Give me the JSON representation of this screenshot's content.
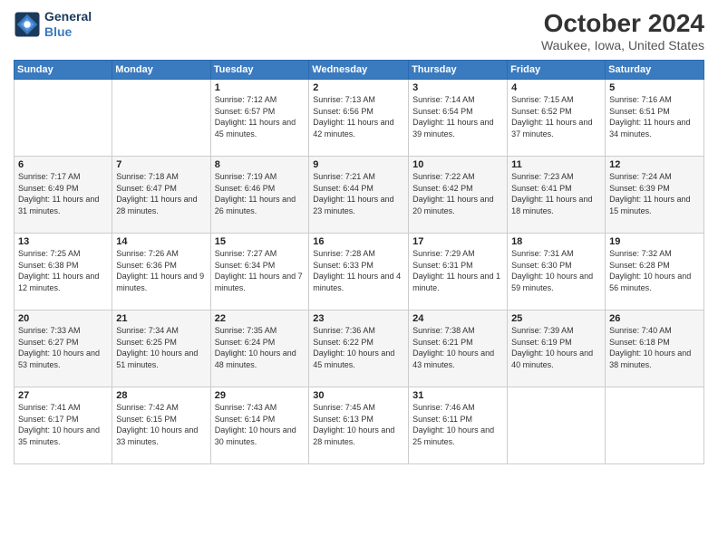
{
  "header": {
    "logo_line1": "General",
    "logo_line2": "Blue",
    "title": "October 2024",
    "subtitle": "Waukee, Iowa, United States"
  },
  "weekdays": [
    "Sunday",
    "Monday",
    "Tuesday",
    "Wednesday",
    "Thursday",
    "Friday",
    "Saturday"
  ],
  "weeks": [
    [
      {
        "day": "",
        "info": ""
      },
      {
        "day": "",
        "info": ""
      },
      {
        "day": "1",
        "info": "Sunrise: 7:12 AM\nSunset: 6:57 PM\nDaylight: 11 hours and 45 minutes."
      },
      {
        "day": "2",
        "info": "Sunrise: 7:13 AM\nSunset: 6:56 PM\nDaylight: 11 hours and 42 minutes."
      },
      {
        "day": "3",
        "info": "Sunrise: 7:14 AM\nSunset: 6:54 PM\nDaylight: 11 hours and 39 minutes."
      },
      {
        "day": "4",
        "info": "Sunrise: 7:15 AM\nSunset: 6:52 PM\nDaylight: 11 hours and 37 minutes."
      },
      {
        "day": "5",
        "info": "Sunrise: 7:16 AM\nSunset: 6:51 PM\nDaylight: 11 hours and 34 minutes."
      }
    ],
    [
      {
        "day": "6",
        "info": "Sunrise: 7:17 AM\nSunset: 6:49 PM\nDaylight: 11 hours and 31 minutes."
      },
      {
        "day": "7",
        "info": "Sunrise: 7:18 AM\nSunset: 6:47 PM\nDaylight: 11 hours and 28 minutes."
      },
      {
        "day": "8",
        "info": "Sunrise: 7:19 AM\nSunset: 6:46 PM\nDaylight: 11 hours and 26 minutes."
      },
      {
        "day": "9",
        "info": "Sunrise: 7:21 AM\nSunset: 6:44 PM\nDaylight: 11 hours and 23 minutes."
      },
      {
        "day": "10",
        "info": "Sunrise: 7:22 AM\nSunset: 6:42 PM\nDaylight: 11 hours and 20 minutes."
      },
      {
        "day": "11",
        "info": "Sunrise: 7:23 AM\nSunset: 6:41 PM\nDaylight: 11 hours and 18 minutes."
      },
      {
        "day": "12",
        "info": "Sunrise: 7:24 AM\nSunset: 6:39 PM\nDaylight: 11 hours and 15 minutes."
      }
    ],
    [
      {
        "day": "13",
        "info": "Sunrise: 7:25 AM\nSunset: 6:38 PM\nDaylight: 11 hours and 12 minutes."
      },
      {
        "day": "14",
        "info": "Sunrise: 7:26 AM\nSunset: 6:36 PM\nDaylight: 11 hours and 9 minutes."
      },
      {
        "day": "15",
        "info": "Sunrise: 7:27 AM\nSunset: 6:34 PM\nDaylight: 11 hours and 7 minutes."
      },
      {
        "day": "16",
        "info": "Sunrise: 7:28 AM\nSunset: 6:33 PM\nDaylight: 11 hours and 4 minutes."
      },
      {
        "day": "17",
        "info": "Sunrise: 7:29 AM\nSunset: 6:31 PM\nDaylight: 11 hours and 1 minute."
      },
      {
        "day": "18",
        "info": "Sunrise: 7:31 AM\nSunset: 6:30 PM\nDaylight: 10 hours and 59 minutes."
      },
      {
        "day": "19",
        "info": "Sunrise: 7:32 AM\nSunset: 6:28 PM\nDaylight: 10 hours and 56 minutes."
      }
    ],
    [
      {
        "day": "20",
        "info": "Sunrise: 7:33 AM\nSunset: 6:27 PM\nDaylight: 10 hours and 53 minutes."
      },
      {
        "day": "21",
        "info": "Sunrise: 7:34 AM\nSunset: 6:25 PM\nDaylight: 10 hours and 51 minutes."
      },
      {
        "day": "22",
        "info": "Sunrise: 7:35 AM\nSunset: 6:24 PM\nDaylight: 10 hours and 48 minutes."
      },
      {
        "day": "23",
        "info": "Sunrise: 7:36 AM\nSunset: 6:22 PM\nDaylight: 10 hours and 45 minutes."
      },
      {
        "day": "24",
        "info": "Sunrise: 7:38 AM\nSunset: 6:21 PM\nDaylight: 10 hours and 43 minutes."
      },
      {
        "day": "25",
        "info": "Sunrise: 7:39 AM\nSunset: 6:19 PM\nDaylight: 10 hours and 40 minutes."
      },
      {
        "day": "26",
        "info": "Sunrise: 7:40 AM\nSunset: 6:18 PM\nDaylight: 10 hours and 38 minutes."
      }
    ],
    [
      {
        "day": "27",
        "info": "Sunrise: 7:41 AM\nSunset: 6:17 PM\nDaylight: 10 hours and 35 minutes."
      },
      {
        "day": "28",
        "info": "Sunrise: 7:42 AM\nSunset: 6:15 PM\nDaylight: 10 hours and 33 minutes."
      },
      {
        "day": "29",
        "info": "Sunrise: 7:43 AM\nSunset: 6:14 PM\nDaylight: 10 hours and 30 minutes."
      },
      {
        "day": "30",
        "info": "Sunrise: 7:45 AM\nSunset: 6:13 PM\nDaylight: 10 hours and 28 minutes."
      },
      {
        "day": "31",
        "info": "Sunrise: 7:46 AM\nSunset: 6:11 PM\nDaylight: 10 hours and 25 minutes."
      },
      {
        "day": "",
        "info": ""
      },
      {
        "day": "",
        "info": ""
      }
    ]
  ]
}
